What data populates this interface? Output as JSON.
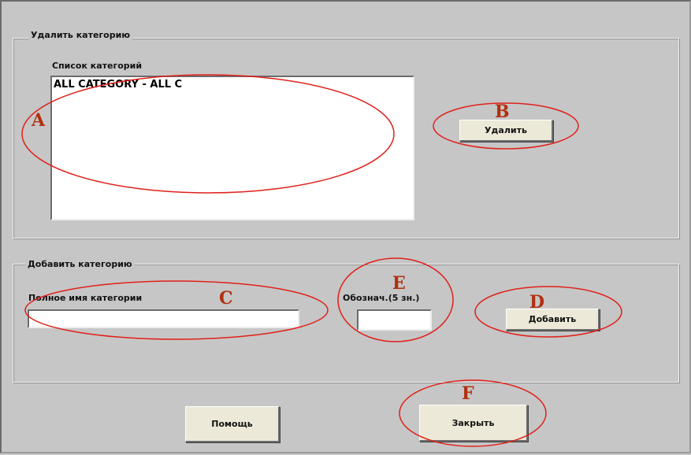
{
  "delete_group": {
    "title": "Удалить категорию",
    "list_label": "Список категорий",
    "list_items": [
      "ALL CATEGORY - ALL C"
    ],
    "delete_button": "Удалить"
  },
  "add_group": {
    "title": "Добавить категорию",
    "fullname_label": "Полное имя категории",
    "fullname_value": "",
    "abbr_label": "Обознач.(5 зн.)",
    "abbr_value": "",
    "add_button": "Добавить"
  },
  "footer": {
    "help_button": "Помощь",
    "close_button": "Закрыть"
  },
  "annotations": {
    "color": "#e0201a",
    "letter_color": "#b0300f",
    "letters": [
      "A",
      "B",
      "C",
      "D",
      "E",
      "F"
    ]
  }
}
